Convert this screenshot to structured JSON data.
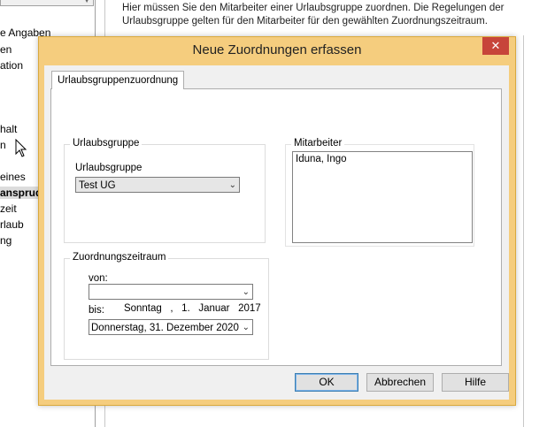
{
  "background": {
    "info_text": "Hier müssen Sie den Mitarbeiter einer Urlaubsgruppe zuordnen. Die Regelungen der Urlaubsgruppe gelten für den Mitarbeiter für den gewählten Zuordnungszeitraum.",
    "left_items": [
      "e Angaben",
      "en",
      "ation",
      "halt",
      "n",
      "eines",
      "ansprud",
      "zeit",
      "rlaub",
      "ng"
    ]
  },
  "dialog": {
    "title": "Neue Zuordnungen erfassen",
    "close_symbol": "✕",
    "tab_label": "Urlaubsgruppenzuordnung",
    "urlaubsgruppe": {
      "legend": "Urlaubsgruppe",
      "field_label": "Urlaubsgruppe",
      "selected": "Test UG"
    },
    "mitarbeiter": {
      "legend": "Mitarbeiter",
      "items": [
        "Iduna, Ingo"
      ]
    },
    "zeitraum": {
      "legend": "Zuordnungszeitraum",
      "von_label": "von:",
      "von_value": "Sonntag   ,   1.   Januar   2017",
      "bis_label": "bis:",
      "bis_value": "Donnerstag, 31. Dezember 2020"
    },
    "buttons": {
      "ok": "OK",
      "cancel": "Abbrechen",
      "help": "Hilfe"
    }
  },
  "colors": {
    "dialog_frame": "#f5cd7e",
    "close_button": "#c7453a",
    "default_button_border": "#3c7fb1"
  }
}
